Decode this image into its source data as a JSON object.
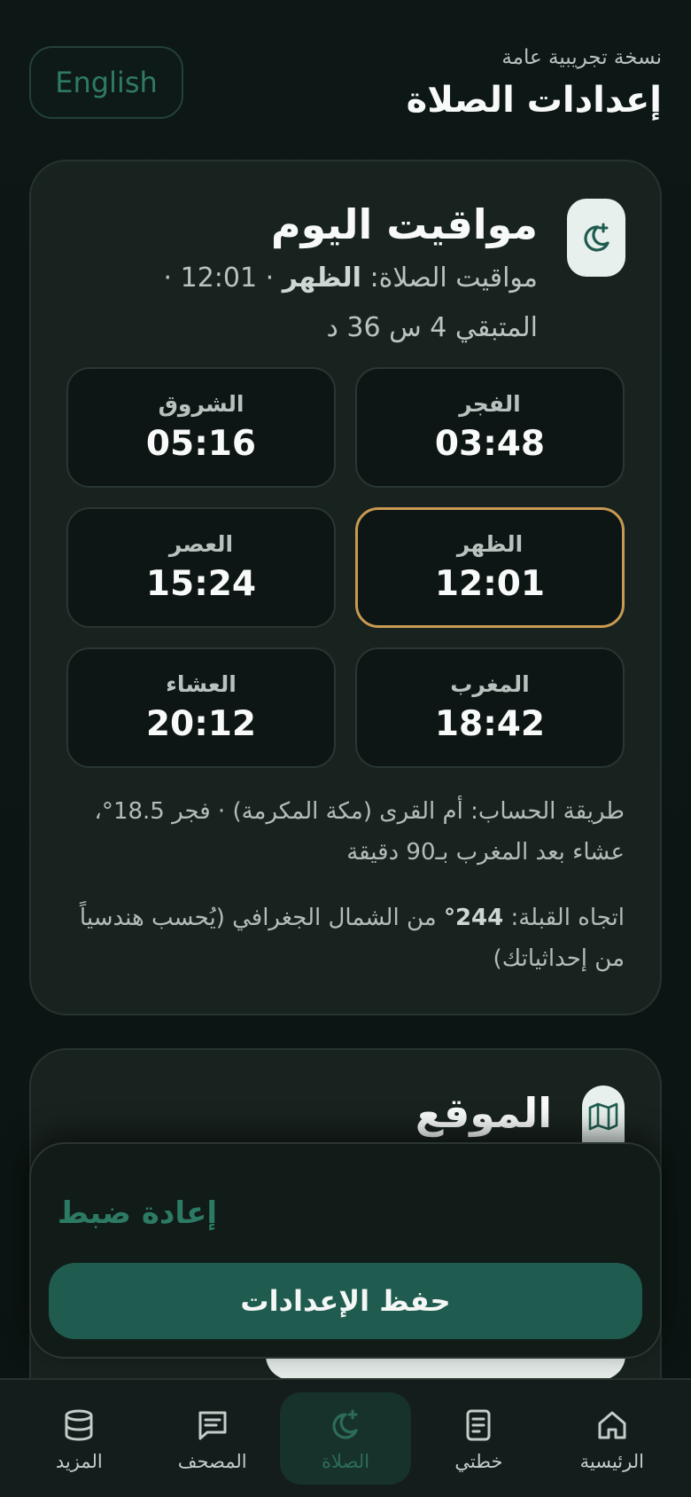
{
  "header": {
    "beta_label": "نسخة تجريبية عامة",
    "title": "إعدادات الصلاة",
    "language_button": "English"
  },
  "today": {
    "title": "مواقيت اليوم",
    "next_prefix": "مواقيت الصلاة: ",
    "next_prayer": "الظهر",
    "next_suffix": " · 12:01 ·",
    "remaining": "المتبقي 4 س 36 د",
    "prayers": [
      {
        "name": "الفجر",
        "time": "03:48",
        "active": false
      },
      {
        "name": "الشروق",
        "time": "05:16",
        "active": false
      },
      {
        "name": "الظهر",
        "time": "12:01",
        "active": true
      },
      {
        "name": "العصر",
        "time": "15:24",
        "active": false
      },
      {
        "name": "المغرب",
        "time": "18:42",
        "active": false
      },
      {
        "name": "العشاء",
        "time": "20:12",
        "active": false
      }
    ],
    "method": "طريقة الحساب: أم القرى (مكة المكرمة) · فجر 18.5°، عشاء بعد المغرب بـ90 دقيقة",
    "qibla_prefix": "اتجاه القبلة: ",
    "qibla_value": "244°",
    "qibla_suffix": " من الشمال الجغرافي (يُحسب هندسياً من إحداثياتك)"
  },
  "location": {
    "title": "الموقع"
  },
  "sheet": {
    "reset_label": "إعادة ضبط",
    "save_label": "حفظ الإعدادات"
  },
  "nav": {
    "items": [
      {
        "label": "الرئيسية",
        "icon": "home-icon",
        "active": false
      },
      {
        "label": "خطتي",
        "icon": "plan-icon",
        "active": false
      },
      {
        "label": "الصلاة",
        "icon": "moon-icon",
        "active": true
      },
      {
        "label": "المصحف",
        "icon": "mushaf-icon",
        "active": false
      },
      {
        "label": "المزيد",
        "icon": "more-icon",
        "active": false
      }
    ]
  },
  "colors": {
    "accent": "#1f5c4f",
    "active_border": "#c89a52",
    "background": "#0c1513"
  }
}
